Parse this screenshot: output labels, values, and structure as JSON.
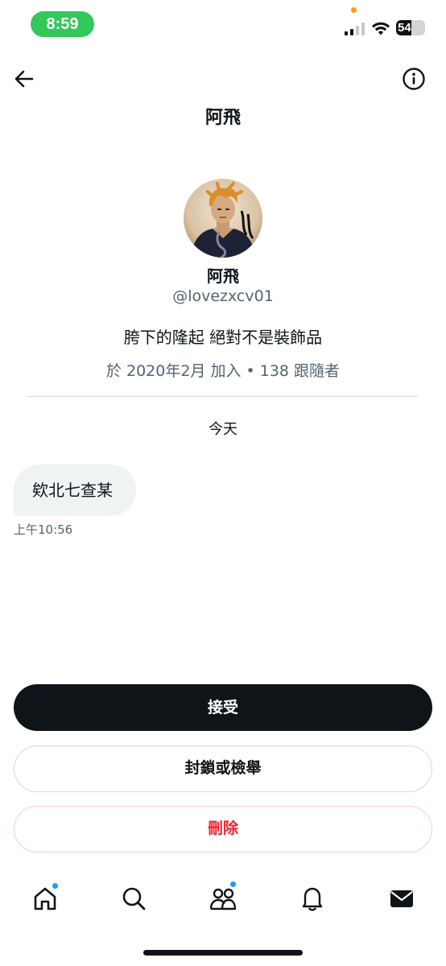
{
  "status_bar": {
    "time": "8:59",
    "battery_level": "54",
    "battery_percent": 54
  },
  "header": {
    "title": "阿飛"
  },
  "profile": {
    "name": "阿飛",
    "handle": "@lovezxcv01",
    "bio": "胯下的隆起 絕對不是裝飾品",
    "meta": "於 2020年2月 加入 • 138 跟隨者"
  },
  "conversation": {
    "date_separator": "今天",
    "messages": [
      {
        "text": "欸北七查某",
        "time": "上午10:56"
      }
    ]
  },
  "actions": {
    "accept_label": "接受",
    "block_report_label": "封鎖或檢舉",
    "delete_label": "刪除"
  },
  "tabs": [
    {
      "icon": "home-icon",
      "has_notification": true
    },
    {
      "icon": "search-icon",
      "has_notification": false
    },
    {
      "icon": "communities-icon",
      "has_notification": true
    },
    {
      "icon": "bell-icon",
      "has_notification": false
    },
    {
      "icon": "envelope-icon",
      "has_notification": false
    }
  ],
  "colors": {
    "accent": "#1d9bf0",
    "primary_text": "#0f1419",
    "secondary_text": "#536471",
    "danger": "#f4212e",
    "time_pill": "#34c759"
  }
}
